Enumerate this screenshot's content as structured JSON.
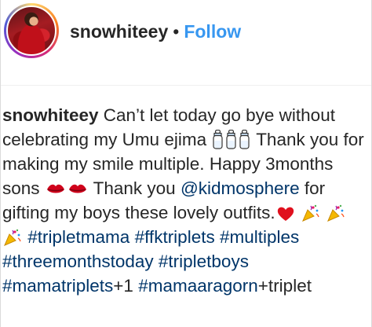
{
  "header": {
    "username": "snowhiteey",
    "separator": "•",
    "follow_label": "Follow"
  },
  "caption": {
    "username": "snowhiteey",
    "text_1": " Can’t let today go bye without celebrating my Umu ejima ",
    "text_2": " Thank you for making my smile multiple. Happy 3months sons ",
    "text_3": " Thank you ",
    "mention": "@kidmosphere",
    "text_4": " for gifting my boys these lovely outfits.",
    "hashtags": {
      "tripletmama": "#tripletmama",
      "ffktriplets": "#ffktriplets",
      "multiples": "#multiples",
      "threemonthstoday": "#threemonthstoday",
      "tripletboys": "#tripletboys",
      "mamatriplets": "#mamatriplets",
      "mamaaragorn": "#mamaaragorn"
    },
    "suffix_1": "+1",
    "suffix_2": "+triplet",
    "emojis": {
      "bottle": "baby-bottle-icon",
      "kiss": "kiss-mark-icon",
      "heart": "red-heart-icon",
      "popper": "party-popper-icon"
    }
  },
  "colors": {
    "follow": "#3897f0",
    "link": "#003569",
    "text": "#262626"
  }
}
